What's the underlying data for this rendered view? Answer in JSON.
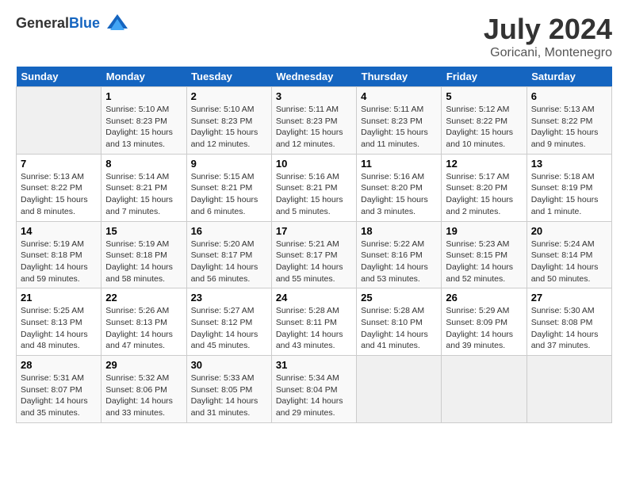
{
  "header": {
    "logo_general": "General",
    "logo_blue": "Blue",
    "title": "July 2024",
    "subtitle": "Goricani, Montenegro"
  },
  "days_of_week": [
    "Sunday",
    "Monday",
    "Tuesday",
    "Wednesday",
    "Thursday",
    "Friday",
    "Saturday"
  ],
  "weeks": [
    [
      {
        "day": "",
        "sunrise": "",
        "sunset": "",
        "daylight": ""
      },
      {
        "day": "1",
        "sunrise": "Sunrise: 5:10 AM",
        "sunset": "Sunset: 8:23 PM",
        "daylight": "Daylight: 15 hours and 13 minutes."
      },
      {
        "day": "2",
        "sunrise": "Sunrise: 5:10 AM",
        "sunset": "Sunset: 8:23 PM",
        "daylight": "Daylight: 15 hours and 12 minutes."
      },
      {
        "day": "3",
        "sunrise": "Sunrise: 5:11 AM",
        "sunset": "Sunset: 8:23 PM",
        "daylight": "Daylight: 15 hours and 12 minutes."
      },
      {
        "day": "4",
        "sunrise": "Sunrise: 5:11 AM",
        "sunset": "Sunset: 8:23 PM",
        "daylight": "Daylight: 15 hours and 11 minutes."
      },
      {
        "day": "5",
        "sunrise": "Sunrise: 5:12 AM",
        "sunset": "Sunset: 8:22 PM",
        "daylight": "Daylight: 15 hours and 10 minutes."
      },
      {
        "day": "6",
        "sunrise": "Sunrise: 5:13 AM",
        "sunset": "Sunset: 8:22 PM",
        "daylight": "Daylight: 15 hours and 9 minutes."
      }
    ],
    [
      {
        "day": "7",
        "sunrise": "Sunrise: 5:13 AM",
        "sunset": "Sunset: 8:22 PM",
        "daylight": "Daylight: 15 hours and 8 minutes."
      },
      {
        "day": "8",
        "sunrise": "Sunrise: 5:14 AM",
        "sunset": "Sunset: 8:21 PM",
        "daylight": "Daylight: 15 hours and 7 minutes."
      },
      {
        "day": "9",
        "sunrise": "Sunrise: 5:15 AM",
        "sunset": "Sunset: 8:21 PM",
        "daylight": "Daylight: 15 hours and 6 minutes."
      },
      {
        "day": "10",
        "sunrise": "Sunrise: 5:16 AM",
        "sunset": "Sunset: 8:21 PM",
        "daylight": "Daylight: 15 hours and 5 minutes."
      },
      {
        "day": "11",
        "sunrise": "Sunrise: 5:16 AM",
        "sunset": "Sunset: 8:20 PM",
        "daylight": "Daylight: 15 hours and 3 minutes."
      },
      {
        "day": "12",
        "sunrise": "Sunrise: 5:17 AM",
        "sunset": "Sunset: 8:20 PM",
        "daylight": "Daylight: 15 hours and 2 minutes."
      },
      {
        "day": "13",
        "sunrise": "Sunrise: 5:18 AM",
        "sunset": "Sunset: 8:19 PM",
        "daylight": "Daylight: 15 hours and 1 minute."
      }
    ],
    [
      {
        "day": "14",
        "sunrise": "Sunrise: 5:19 AM",
        "sunset": "Sunset: 8:18 PM",
        "daylight": "Daylight: 14 hours and 59 minutes."
      },
      {
        "day": "15",
        "sunrise": "Sunrise: 5:19 AM",
        "sunset": "Sunset: 8:18 PM",
        "daylight": "Daylight: 14 hours and 58 minutes."
      },
      {
        "day": "16",
        "sunrise": "Sunrise: 5:20 AM",
        "sunset": "Sunset: 8:17 PM",
        "daylight": "Daylight: 14 hours and 56 minutes."
      },
      {
        "day": "17",
        "sunrise": "Sunrise: 5:21 AM",
        "sunset": "Sunset: 8:17 PM",
        "daylight": "Daylight: 14 hours and 55 minutes."
      },
      {
        "day": "18",
        "sunrise": "Sunrise: 5:22 AM",
        "sunset": "Sunset: 8:16 PM",
        "daylight": "Daylight: 14 hours and 53 minutes."
      },
      {
        "day": "19",
        "sunrise": "Sunrise: 5:23 AM",
        "sunset": "Sunset: 8:15 PM",
        "daylight": "Daylight: 14 hours and 52 minutes."
      },
      {
        "day": "20",
        "sunrise": "Sunrise: 5:24 AM",
        "sunset": "Sunset: 8:14 PM",
        "daylight": "Daylight: 14 hours and 50 minutes."
      }
    ],
    [
      {
        "day": "21",
        "sunrise": "Sunrise: 5:25 AM",
        "sunset": "Sunset: 8:13 PM",
        "daylight": "Daylight: 14 hours and 48 minutes."
      },
      {
        "day": "22",
        "sunrise": "Sunrise: 5:26 AM",
        "sunset": "Sunset: 8:13 PM",
        "daylight": "Daylight: 14 hours and 47 minutes."
      },
      {
        "day": "23",
        "sunrise": "Sunrise: 5:27 AM",
        "sunset": "Sunset: 8:12 PM",
        "daylight": "Daylight: 14 hours and 45 minutes."
      },
      {
        "day": "24",
        "sunrise": "Sunrise: 5:28 AM",
        "sunset": "Sunset: 8:11 PM",
        "daylight": "Daylight: 14 hours and 43 minutes."
      },
      {
        "day": "25",
        "sunrise": "Sunrise: 5:28 AM",
        "sunset": "Sunset: 8:10 PM",
        "daylight": "Daylight: 14 hours and 41 minutes."
      },
      {
        "day": "26",
        "sunrise": "Sunrise: 5:29 AM",
        "sunset": "Sunset: 8:09 PM",
        "daylight": "Daylight: 14 hours and 39 minutes."
      },
      {
        "day": "27",
        "sunrise": "Sunrise: 5:30 AM",
        "sunset": "Sunset: 8:08 PM",
        "daylight": "Daylight: 14 hours and 37 minutes."
      }
    ],
    [
      {
        "day": "28",
        "sunrise": "Sunrise: 5:31 AM",
        "sunset": "Sunset: 8:07 PM",
        "daylight": "Daylight: 14 hours and 35 minutes."
      },
      {
        "day": "29",
        "sunrise": "Sunrise: 5:32 AM",
        "sunset": "Sunset: 8:06 PM",
        "daylight": "Daylight: 14 hours and 33 minutes."
      },
      {
        "day": "30",
        "sunrise": "Sunrise: 5:33 AM",
        "sunset": "Sunset: 8:05 PM",
        "daylight": "Daylight: 14 hours and 31 minutes."
      },
      {
        "day": "31",
        "sunrise": "Sunrise: 5:34 AM",
        "sunset": "Sunset: 8:04 PM",
        "daylight": "Daylight: 14 hours and 29 minutes."
      },
      {
        "day": "",
        "sunrise": "",
        "sunset": "",
        "daylight": ""
      },
      {
        "day": "",
        "sunrise": "",
        "sunset": "",
        "daylight": ""
      },
      {
        "day": "",
        "sunrise": "",
        "sunset": "",
        "daylight": ""
      }
    ]
  ]
}
